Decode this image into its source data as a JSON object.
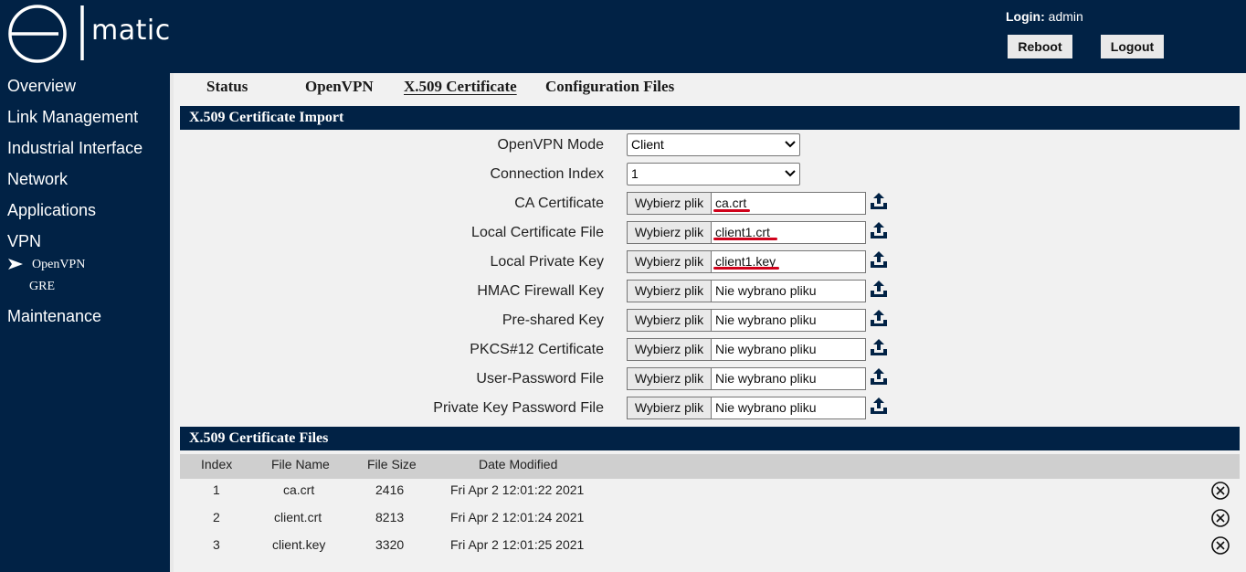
{
  "brand": {
    "logo_text": "matic"
  },
  "header": {
    "login_label": "Login:",
    "login_user": "admin",
    "reboot_label": "Reboot",
    "logout_label": "Logout"
  },
  "sidebar": {
    "items": [
      {
        "label": "Overview"
      },
      {
        "label": "Link Management"
      },
      {
        "label": "Industrial Interface"
      },
      {
        "label": "Network"
      },
      {
        "label": "Applications"
      },
      {
        "label": "VPN"
      },
      {
        "label": "Maintenance"
      }
    ],
    "vpn_sub": [
      {
        "label": "OpenVPN",
        "active": true
      },
      {
        "label": "GRE",
        "active": false
      }
    ]
  },
  "tabs": [
    {
      "label": "Status",
      "active": false
    },
    {
      "label": "OpenVPN",
      "active": false
    },
    {
      "label": "X.509 Certificate",
      "active": true
    },
    {
      "label": "Configuration Files",
      "active": false
    }
  ],
  "import_section": {
    "title": "X.509 Certificate Import",
    "openvpn_mode": {
      "label": "OpenVPN Mode",
      "value": "Client"
    },
    "connection_index": {
      "label": "Connection Index",
      "value": "1"
    },
    "file_button_label": "Wybierz plik",
    "files": [
      {
        "label": "CA Certificate",
        "file": "ca.crt"
      },
      {
        "label": "Local Certificate File",
        "file": "client1.crt"
      },
      {
        "label": "Local Private Key",
        "file": "client1.key"
      },
      {
        "label": "HMAC Firewall Key",
        "file": "Nie wybrano pliku"
      },
      {
        "label": "Pre-shared Key",
        "file": "Nie wybrano pliku"
      },
      {
        "label": "PKCS#12 Certificate",
        "file": "Nie wybrano pliku"
      },
      {
        "label": "User-Password File",
        "file": "Nie wybrano pliku"
      },
      {
        "label": "Private Key Password File",
        "file": "Nie wybrano pliku"
      }
    ],
    "highlight_color": "#d0021b"
  },
  "files_section": {
    "title": "X.509 Certificate Files",
    "columns": [
      "Index",
      "File Name",
      "File Size",
      "Date Modified"
    ],
    "rows": [
      {
        "index": "1",
        "name": "ca.crt",
        "size": "2416",
        "date": "Fri Apr 2 12:01:22 2021"
      },
      {
        "index": "2",
        "name": "client.crt",
        "size": "8213",
        "date": "Fri Apr 2 12:01:24 2021"
      },
      {
        "index": "3",
        "name": "client.key",
        "size": "3320",
        "date": "Fri Apr 2 12:01:25 2021"
      }
    ]
  },
  "icons": {
    "upload": "upload-icon",
    "delete": "delete-circle-x-icon",
    "nav_arrow": "arrow-right-icon",
    "dropdown": "chevron-down-icon"
  },
  "colors": {
    "navy": "#012245",
    "background": "#f1f1f1",
    "table_header": "#cfcfcf"
  }
}
